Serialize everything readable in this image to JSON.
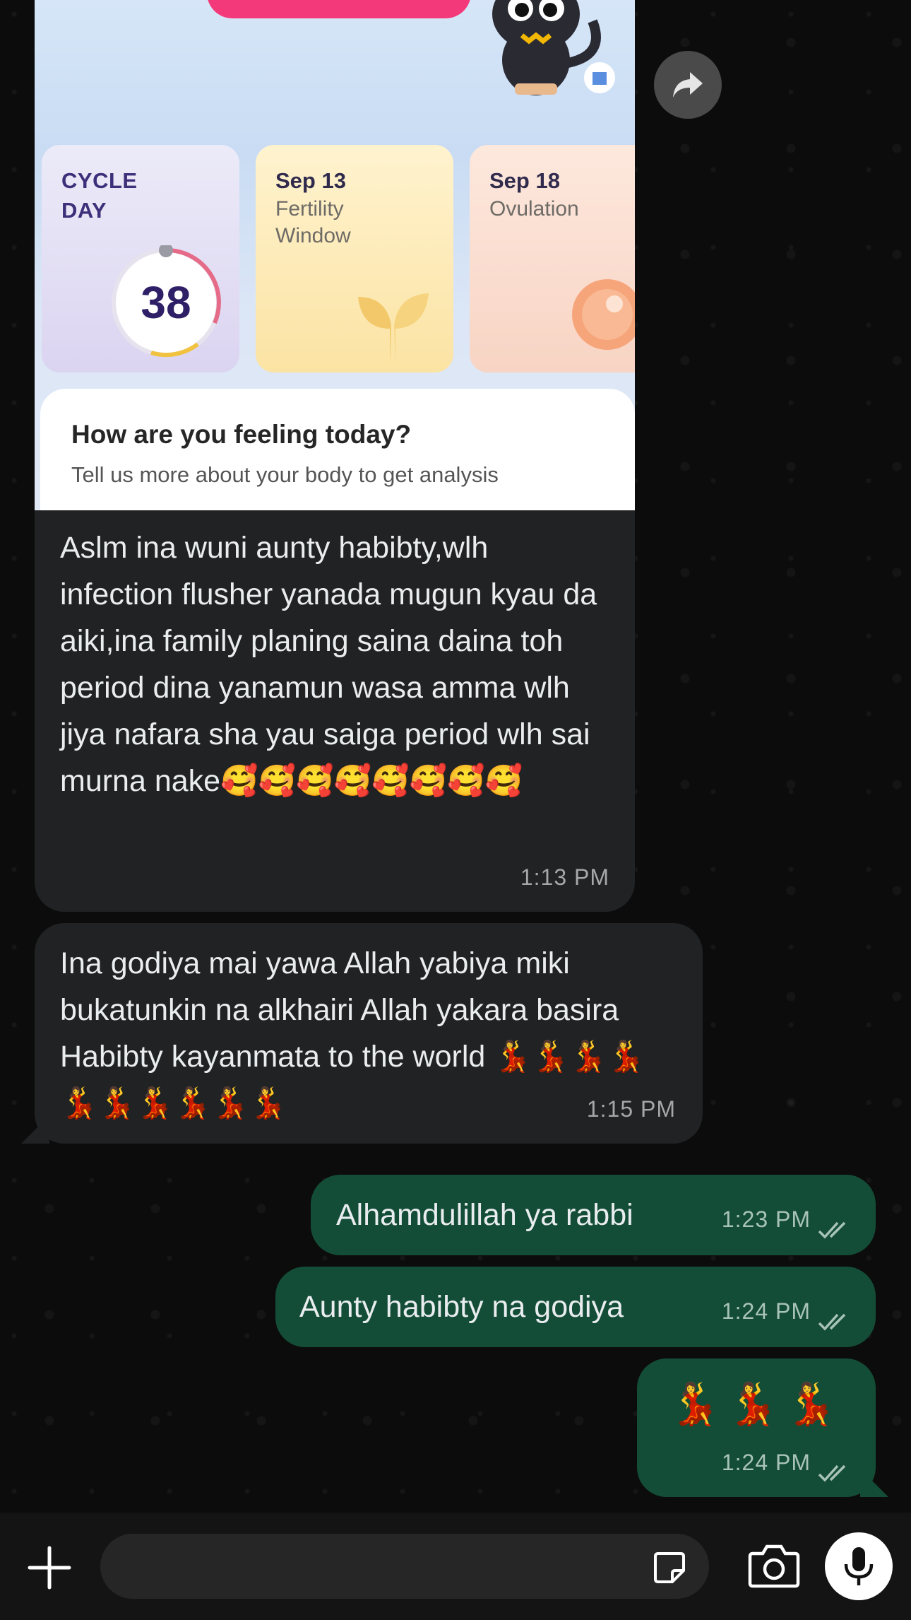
{
  "shared_image": {
    "cycle_card": {
      "title_line1": "CYCLE",
      "title_line2": "DAY",
      "day_number": "38"
    },
    "fertility_card": {
      "date": "Sep 13",
      "label_line1": "Fertility",
      "label_line2": "Window"
    },
    "ovulation_card": {
      "date": "Sep 18",
      "label": "Ovulation"
    },
    "feeling_card": {
      "title": "How are you feeling today?",
      "subtitle": "Tell us more about your body to get analysis"
    }
  },
  "messages": [
    {
      "direction": "incoming",
      "text": "Aslm ina wuni aunty habibty,wlh infection flusher yanada mugun kyau da aiki,ina family planing saina daina toh period dina yanamun wasa amma wlh jiya nafara sha yau saiga period wlh sai murna nake🥰🥰🥰🥰🥰🥰🥰🥰",
      "time": "1:13 PM"
    },
    {
      "direction": "incoming",
      "text": "Ina godiya mai yawa Allah yabiya miki bukatunkin na alkhairi Allah yakara basira Habibty kayanmata to the world 💃💃💃💃💃💃💃💃💃💃",
      "time": "1:15 PM"
    },
    {
      "direction": "outgoing",
      "text": "Alhamdulillah ya rabbi",
      "time": "1:23 PM",
      "status": "read"
    },
    {
      "direction": "outgoing",
      "text": "Aunty habibty na godiya",
      "time": "1:24 PM",
      "status": "read"
    },
    {
      "direction": "outgoing",
      "text": "💃💃💃",
      "time": "1:24 PM",
      "status": "read"
    }
  ],
  "composer": {
    "placeholder": "",
    "icons": [
      "plus-icon",
      "sticker-icon",
      "camera-icon",
      "microphone-icon"
    ]
  },
  "colors": {
    "incoming_bubble": "#202223",
    "outgoing_bubble": "#144d37",
    "read_ticks": "#a8c3b7",
    "accent_pink": "#f4397a"
  }
}
